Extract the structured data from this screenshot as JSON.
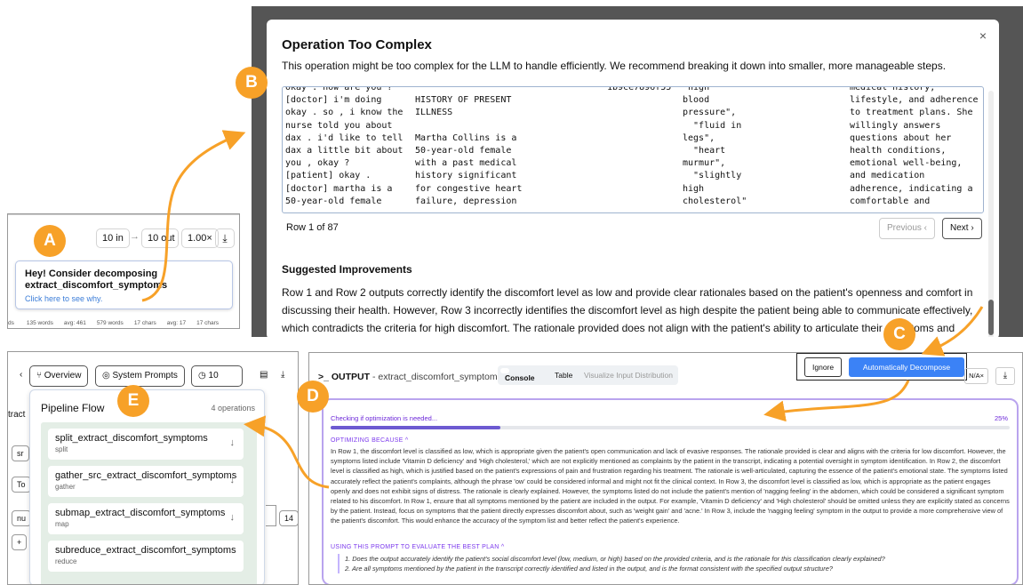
{
  "panelA": {
    "io_in": "10 in",
    "arrow": "→",
    "io_out": "10 out",
    "zoom": "1.00×",
    "tooltip_title": "Hey! Consider decomposing extract_discomfort_symptoms",
    "tooltip_link": "Click here to see why.",
    "stats": [
      "ds",
      "135 words",
      "avg: 461",
      "579 words",
      "17 chars",
      "avg: 17",
      "17 chars"
    ]
  },
  "modal": {
    "title": "Operation Too Complex",
    "description": "This operation might be too complex for the LLM to handle efficiently. We recommend breaking it down into smaller, more manageable steps.",
    "close": "×",
    "columns": [
      "okay . how are you ?\n[doctor] i'm doing\nokay . so , i know the\nnurse told you about\ndax . i'd like to tell\ndax a little bit about\nyou , okay ?\n[patient] okay .\n[doctor] martha is a\n50-year-old female",
      "\nHISTORY OF PRESENT\nILLNESS\n\nMartha Collins is a\n50-year-old female\nwith a past medical\nhistory significant\nfor congestive heart\nfailure, depression",
      "1b9ce7896f55",
      "\"high\nblood\npressure\",\n  \"fluid in\nlegs\",\n  \"heart\nmurmur\",\n  \"slightly\nhigh\ncholesterol\"",
      "medical history,\nlifestyle, and adherence\nto treatment plans. She\nwillingly answers\nquestions about her\nhealth conditions,\nemotional well-being,\nand medication\nadherence, indicating a\ncomfortable and"
    ],
    "row_info": "Row 1 of 87",
    "prev": "Previous ‹",
    "next": "Next ›",
    "suggested_title": "Suggested Improvements",
    "suggested_text": "Row 1 and Row 2 outputs correctly identify the discomfort level as low and provide clear rationales based on the patient's openness and comfort in discussing their health. However, Row 3 incorrectly identifies the discomfort level as high despite the patient being able to communicate effectively, which contradicts the criteria for high discomfort. The rationale provided does not align with the patient's ability to articulate their symptoms and concerns, indicating a misclassification."
  },
  "panelE": {
    "overview": "Overview",
    "system_prompts": "System Prompts",
    "count": "10",
    "flow_title": "Pipeline Flow",
    "flow_count": "4 operations",
    "side_labels": [
      "tract",
      "sr",
      "To",
      "nu",
      "+",
      "14"
    ],
    "operations": [
      {
        "name": "split_extract_discomfort_symptoms",
        "type": "split"
      },
      {
        "name": "gather_src_extract_discomfort_symptoms",
        "type": "gather"
      },
      {
        "name": "submap_extract_discomfort_symptoms",
        "type": "map"
      },
      {
        "name": "subreduce_extract_discomfort_symptoms",
        "type": "reduce"
      }
    ]
  },
  "panelD": {
    "output_label": "OUTPUT",
    "output_name": " - extract_discomfort_symptoms",
    "tabs": [
      "Console",
      "Table",
      "Visualize Input Distribution"
    ],
    "ignore": "Ignore",
    "auto": "Automatically Decompose",
    "na": "N/A×",
    "checking": "Checking if optimization is needed...",
    "percent": "25%",
    "progress": 0.25,
    "optimizing_head": "OPTIMIZING BECAUSE ^",
    "reason": "In Row 1, the discomfort level is classified as low, which is appropriate given the patient's open communication and lack of evasive responses. The rationale provided is clear and aligns with the criteria for low discomfort. However, the symptoms listed include 'Vitamin D deficiency' and 'High cholesterol,' which are not explicitly mentioned as complaints by the patient in the transcript, indicating a potential oversight in symptom identification. In Row 2, the discomfort level is classified as high, which is justified based on the patient's expressions of pain and frustration regarding his treatment. The rationale is well-articulated, capturing the essence of the patient's emotional state. The symptoms listed accurately reflect the patient's complaints, although the phrase 'ow' could be considered informal and might not fit the clinical context. In Row 3, the discomfort level is classified as low, which is appropriate as the patient engages openly and does not exhibit signs of distress. The rationale is clearly explained. However, the symptoms listed do not include the patient's mention of 'nagging feeling' in the abdomen, which could be considered a significant symptom related to his discomfort. In Row 1, ensure that all symptoms mentioned by the patient are included in the output. For example, 'Vitamin D deficiency' and 'High cholesterol' should be omitted unless they are explicitly stated as concerns by the patient. Instead, focus on symptoms that the patient directly expresses discomfort about, such as 'weight gain' and 'acne.' In Row 3, include the 'nagging feeling' symptom in the output to provide a more comprehensive view of the patient's discomfort. This would enhance the accuracy of the symptom list and better reflect the patient's experience.",
    "prompt_head": "USING THIS PROMPT TO EVALUATE THE BEST PLAN ^",
    "questions": [
      "1. Does the output accurately identify the patient's social discomfort level (low, medium, or high) based on the provided criteria, and is the rationale for this classification clearly explained?",
      "2. Are all symptoms mentioned by the patient in the transcript correctly identified and listed in the output, and is the format consistent with the specified output structure?"
    ]
  },
  "markers": [
    "A",
    "B",
    "C",
    "D",
    "E"
  ],
  "colors": {
    "marker": "#f7a128",
    "accent": "#3b82f6",
    "optimize": "#7c3aed"
  }
}
